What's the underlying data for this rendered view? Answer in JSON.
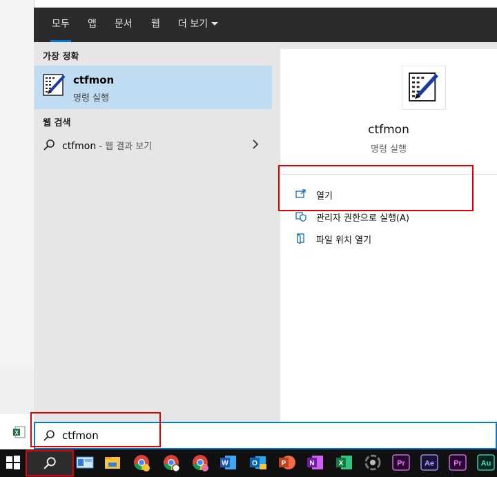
{
  "tabs": [
    {
      "label": "모두",
      "active": true
    },
    {
      "label": "앱"
    },
    {
      "label": "문서"
    },
    {
      "label": "웹"
    },
    {
      "label": "더 보기"
    }
  ],
  "best_match": {
    "heading": "가장 정확",
    "title": "ctfmon",
    "subtitle": "명령 실행"
  },
  "web_search": {
    "heading": "웹 검색",
    "query": "ctfmon",
    "suffix": " - 웹 결과 보기"
  },
  "detail": {
    "title": "ctfmon",
    "subtitle": "명령 실행",
    "actions": [
      {
        "label": "열기",
        "icon": "open-icon"
      },
      {
        "label": "관리자 권한으로 실행(A)",
        "icon": "shield-icon"
      },
      {
        "label": "파일 위치 열기",
        "icon": "file-location-icon"
      }
    ]
  },
  "search": {
    "value": "ctfmon"
  },
  "taskbar": {
    "apps": [
      "windows-start",
      "search",
      "control-panel",
      "file-explorer",
      "chrome",
      "chrome",
      "chrome",
      "word",
      "outlook",
      "powerpoint",
      "onenote",
      "excel",
      "davinci",
      "premiere-pro",
      "after-effects",
      "premiere-pro",
      "audition"
    ],
    "labels": {
      "pr": "Pr",
      "ae": "Ae",
      "au": "Au",
      "w": "W",
      "o": "O",
      "p": "P",
      "n": "N",
      "x": "X"
    }
  },
  "colors": {
    "accent": "#0078d7",
    "highlight": "#c0dcf3",
    "annotation": "#e00000",
    "tabbar": "#2b2b2b"
  }
}
